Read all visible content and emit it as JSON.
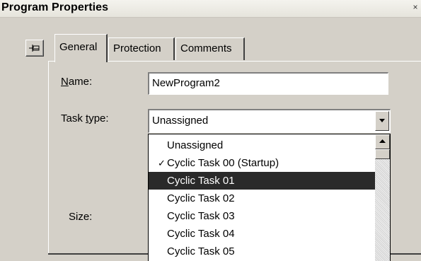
{
  "window": {
    "title": "Program Properties",
    "close_glyph": "×"
  },
  "tabs": [
    {
      "label": "General",
      "active": true
    },
    {
      "label": "Protection",
      "active": false
    },
    {
      "label": "Comments",
      "active": false
    }
  ],
  "form": {
    "name_label_mnemonic": "N",
    "name_label_rest": "ame:",
    "name_value": "NewProgram2",
    "task_label_pre": "Task ",
    "task_label_mnemonic": "t",
    "task_label_rest": "ype:",
    "task_value": "Unassigned",
    "size_label": "Size:"
  },
  "task_options": [
    {
      "label": "Unassigned",
      "checked": false,
      "highlighted": false
    },
    {
      "label": "Cyclic Task 00 (Startup)",
      "checked": true,
      "highlighted": false
    },
    {
      "label": "Cyclic Task 01",
      "checked": false,
      "highlighted": true
    },
    {
      "label": "Cyclic Task 02",
      "checked": false,
      "highlighted": false
    },
    {
      "label": "Cyclic Task 03",
      "checked": false,
      "highlighted": false
    },
    {
      "label": "Cyclic Task 04",
      "checked": false,
      "highlighted": false
    },
    {
      "label": "Cyclic Task 05",
      "checked": false,
      "highlighted": false
    }
  ],
  "icons": {
    "pin": "pin-icon",
    "dropdown_arrow": "chevron-down-icon",
    "scroll_up": "arrow-up-icon",
    "check": "checkmark-icon"
  },
  "colors": {
    "face": "#d4d0c8",
    "highlight": "#2a2a2a",
    "field": "#ffffff"
  }
}
